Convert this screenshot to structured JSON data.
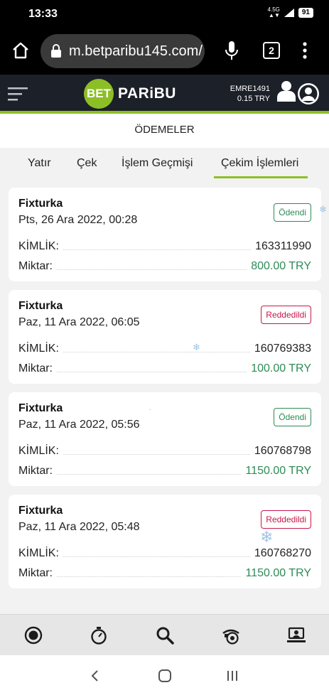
{
  "status_bar": {
    "time": "13:33",
    "network_line1": "4.5G",
    "network_line2": "▲▼",
    "battery": "91"
  },
  "browser": {
    "url": "m.betparibu145.com/",
    "tab_count": "2"
  },
  "header": {
    "logo_bet": "BET",
    "logo_paribu": "PARiBU",
    "username": "EMRE1491",
    "balance": "0.15 TRY",
    "accent_color": "#8cbf26"
  },
  "page": {
    "title": "ÖDEMELER"
  },
  "tabs": [
    {
      "label": "Yatır"
    },
    {
      "label": "Çek"
    },
    {
      "label": "İşlem Geçmişi"
    },
    {
      "label": "Çekim İşlemleri"
    }
  ],
  "withdrawals": [
    {
      "provider": "Fixturka",
      "date": "Pts, 26 Ara 2022, 00:28",
      "status": "Ödendi",
      "id_label": "KİMLİK:",
      "id": "163311990",
      "amount_label": "Miktar:",
      "amount": "800.00 TRY"
    },
    {
      "provider": "Fixturka",
      "date": "Paz, 11 Ara 2022, 06:05",
      "status": "Reddedildi",
      "id_label": "KİMLİK:",
      "id": "160769383",
      "amount_label": "Miktar:",
      "amount": "100.00 TRY"
    },
    {
      "provider": "Fixturka",
      "date": "Paz, 11 Ara 2022, 05:56",
      "status": "Ödendi",
      "id_label": "KİMLİK:",
      "id": "160768798",
      "amount_label": "Miktar:",
      "amount": "1150.00 TRY"
    },
    {
      "provider": "Fixturka",
      "date": "Paz, 11 Ara 2022, 05:48",
      "status": "Reddedildi",
      "id_label": "KİMLİK:",
      "id": "160768270",
      "amount_label": "Miktar:",
      "amount": "1150.00 TRY"
    }
  ],
  "bottom_nav": [
    {
      "icon": "live-icon"
    },
    {
      "icon": "stopwatch-icon"
    },
    {
      "icon": "search-icon"
    },
    {
      "icon": "casino-chip-icon"
    },
    {
      "icon": "live-casino-icon"
    }
  ],
  "colors": {
    "paid": "#2e8b57",
    "rejected": "#c8174b"
  }
}
